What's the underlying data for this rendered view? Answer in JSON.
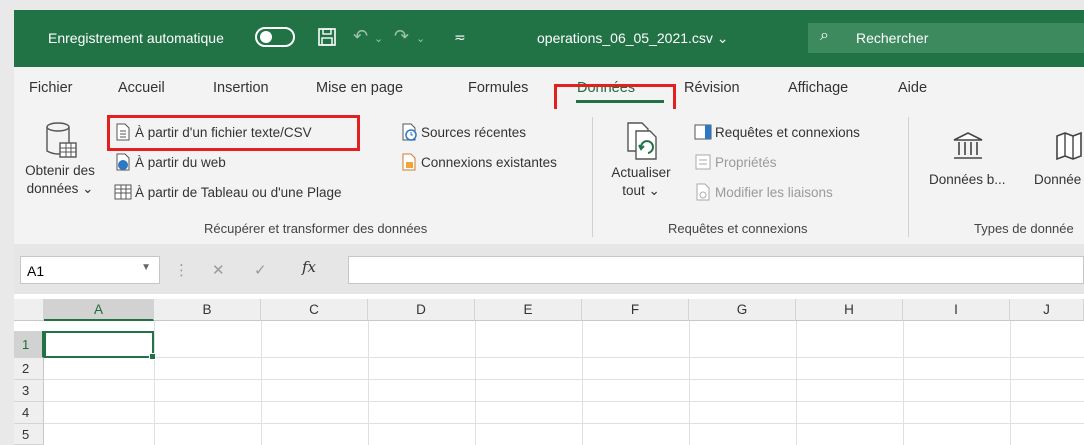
{
  "titlebar": {
    "autosave_label": "Enregistrement automatique",
    "autosave_state": "off",
    "save_icon": "save-icon",
    "undo_icon": "undo-icon",
    "redo_icon": "redo-icon",
    "customize_icon": "customize-quick-access-icon",
    "filename": "operations_06_05_2021.csv ⌄",
    "search_placeholder": "Rechercher",
    "accent": "#217346"
  },
  "tabs": [
    {
      "label": "Fichier"
    },
    {
      "label": "Accueil"
    },
    {
      "label": "Insertion"
    },
    {
      "label": "Mise en page"
    },
    {
      "label": "Formules"
    },
    {
      "label": "Données",
      "active": true
    },
    {
      "label": "Révision"
    },
    {
      "label": "Affichage"
    },
    {
      "label": "Aide"
    }
  ],
  "ribbon": {
    "get_data": {
      "line1": "Obtenir des",
      "line2": "données ⌄"
    },
    "from_text_csv": "À partir d'un fichier texte/CSV",
    "from_web": "À partir du web",
    "from_table": "À partir de Tableau ou d'une Plage",
    "recent_sources": "Sources récentes",
    "existing_connections": "Connexions existantes",
    "group1_label": "Récupérer et transformer des données",
    "refresh": {
      "line1": "Actualiser",
      "line2": "tout ⌄"
    },
    "queries_connections": "Requêtes et connexions",
    "properties": "Propriétés",
    "edit_links": "Modifier les liaisons",
    "group2_label": "Requêtes et connexions",
    "data_types_1": "Données b...",
    "data_types_2": "Donnée",
    "group3_label": "Types de donnée"
  },
  "formula_bar": {
    "name_box": "A1",
    "fx": "fx",
    "value": ""
  },
  "grid": {
    "columns": [
      "A",
      "B",
      "C",
      "D",
      "E",
      "F",
      "G",
      "H",
      "I",
      "J"
    ],
    "rows": [
      "1",
      "2",
      "3",
      "4",
      "5"
    ],
    "active_cell": "A1"
  },
  "highlight_color": "#e32020"
}
